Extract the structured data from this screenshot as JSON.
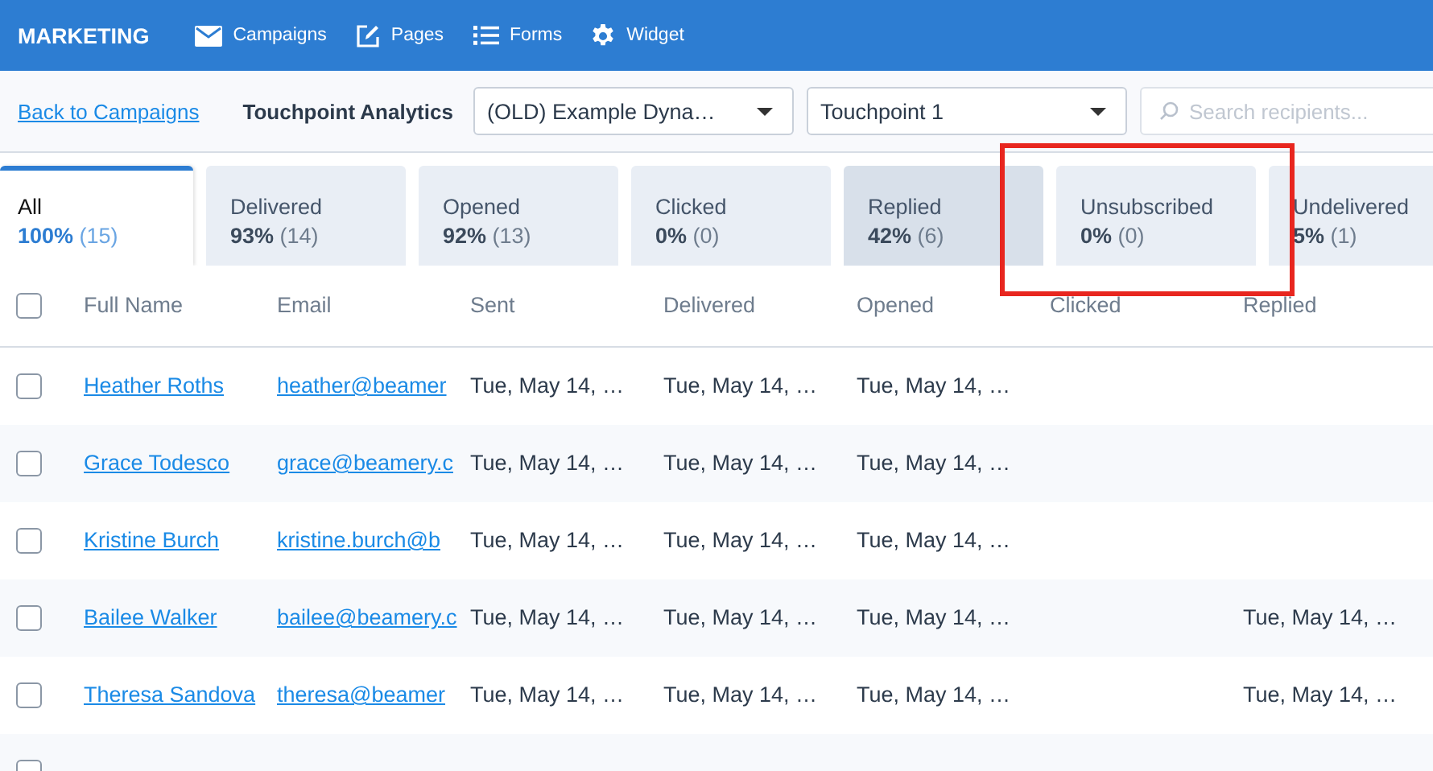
{
  "header": {
    "title": "MARKETING",
    "nav": [
      {
        "label": "Campaigns"
      },
      {
        "label": "Pages"
      },
      {
        "label": "Forms"
      },
      {
        "label": "Widget"
      }
    ]
  },
  "toolbar": {
    "back_link": "Back to Campaigns",
    "title": "Touchpoint Analytics",
    "campaign_select": "(OLD) Example Dyna…",
    "touchpoint_select": "Touchpoint 1",
    "search": {
      "placeholder": "Search recipients..."
    }
  },
  "tabs": [
    {
      "label": "All",
      "percent": "100%",
      "count": "(15)",
      "selected": true,
      "hovered": false
    },
    {
      "label": "Delivered",
      "percent": "93%",
      "count": "(14)",
      "selected": false,
      "hovered": false
    },
    {
      "label": "Opened",
      "percent": "92%",
      "count": "(13)",
      "selected": false,
      "hovered": false
    },
    {
      "label": "Clicked",
      "percent": "0%",
      "count": "(0)",
      "selected": false,
      "hovered": false
    },
    {
      "label": "Replied",
      "percent": "42%",
      "count": "(6)",
      "selected": false,
      "hovered": true
    },
    {
      "label": "Unsubscribed",
      "percent": "0%",
      "count": "(0)",
      "selected": false,
      "hovered": false
    },
    {
      "label": "Undelivered",
      "percent": "5%",
      "count": "(1)",
      "selected": false,
      "hovered": false
    }
  ],
  "table": {
    "select_all_checked": false,
    "columns": [
      "Full Name",
      "Email",
      "Sent",
      "Delivered",
      "Opened",
      "Clicked",
      "Replied"
    ],
    "rows": [
      {
        "checked": false,
        "cells": [
          "Heather Roths",
          "heather@beamer",
          "Tue, May 14, …",
          "Tue, May 14, …",
          "Tue, May 14, …",
          null,
          null
        ]
      },
      {
        "checked": false,
        "cells": [
          "Grace Todesco",
          "grace@beamery.c",
          "Tue, May 14, …",
          "Tue, May 14, …",
          "Tue, May 14, …",
          null,
          null
        ]
      },
      {
        "checked": false,
        "cells": [
          "Kristine Burch",
          "kristine.burch@b",
          "Tue, May 14, …",
          "Tue, May 14, …",
          "Tue, May 14, …",
          null,
          null
        ]
      },
      {
        "checked": false,
        "cells": [
          "Bailee Walker",
          "bailee@beamery.c",
          "Tue, May 14, …",
          "Tue, May 14, …",
          "Tue, May 14, …",
          null,
          "Tue, May 14, …"
        ]
      },
      {
        "checked": false,
        "cells": [
          "Theresa Sandova",
          "theresa@beamer",
          "Tue, May 14, …",
          "Tue, May 14, …",
          "Tue, May 14, …",
          null,
          "Tue, May 14, …"
        ]
      },
      {
        "checked": false
      }
    ]
  }
}
